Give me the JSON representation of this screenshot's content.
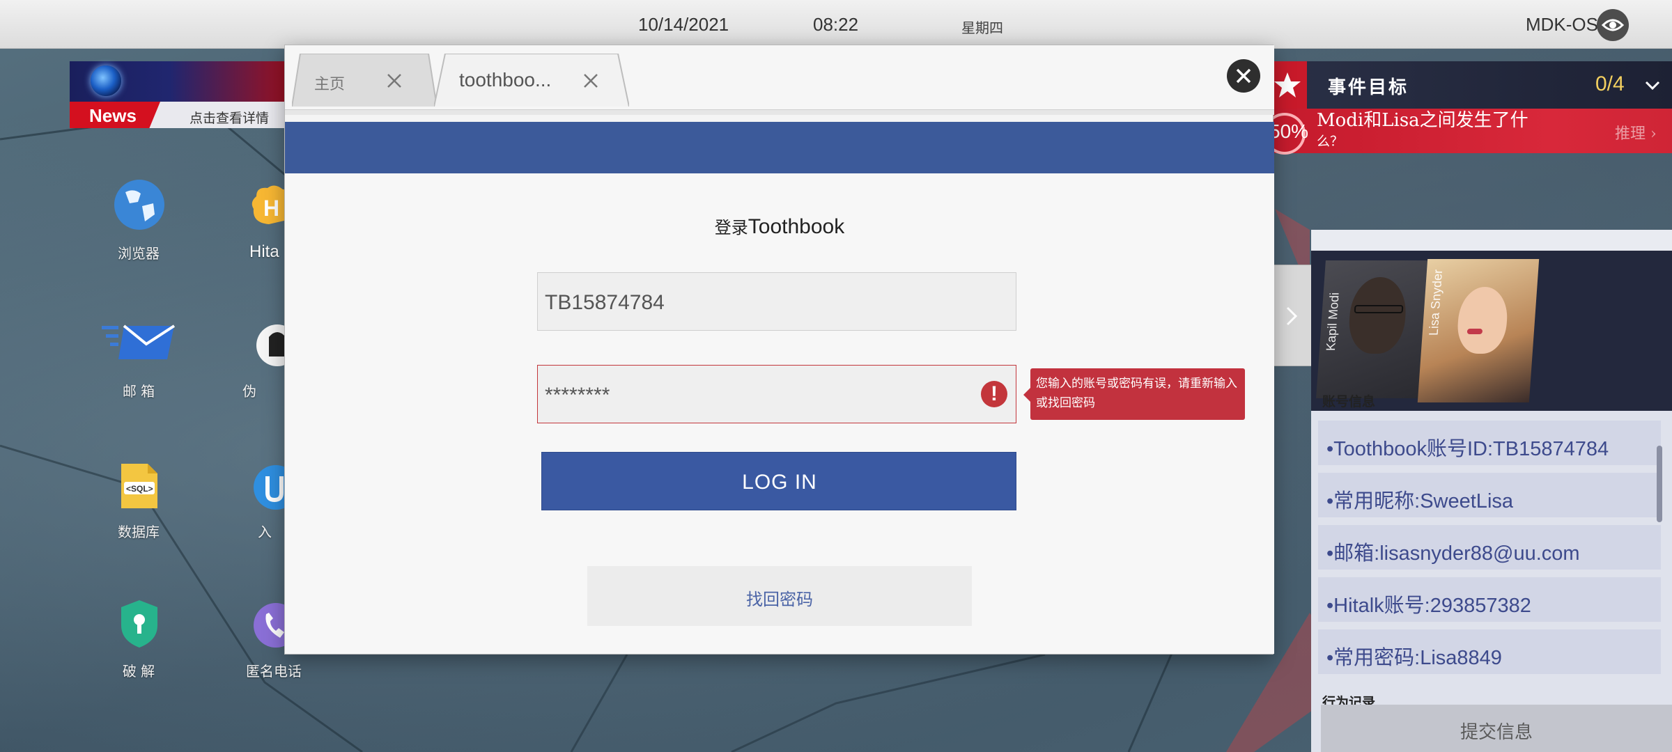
{
  "statusbar": {
    "date": "10/14/2021",
    "time": "08:22",
    "weekday": "星期四",
    "os_name": "MDK-OS"
  },
  "news": {
    "tag": "News",
    "ticker": "点击查看详情"
  },
  "desktop_icons": [
    {
      "label": "浏览器",
      "icon": "globe-icon"
    },
    {
      "label": "Hita",
      "icon": "hitalk-icon"
    },
    {
      "label": "邮 箱",
      "icon": "mail-icon"
    },
    {
      "label": "伪",
      "icon": "disguise-icon"
    },
    {
      "label": "数据库",
      "icon": "sql-database-icon"
    },
    {
      "label": "入",
      "icon": "intrusion-icon"
    },
    {
      "label": "破 解",
      "icon": "crack-shield-icon"
    },
    {
      "label": "匿名电话",
      "icon": "phone-icon"
    }
  ],
  "browser": {
    "tabs": [
      {
        "title": "主页",
        "active": false
      },
      {
        "title": "toothboo...",
        "active": true
      }
    ],
    "brand_color": "#3c5a9a",
    "login": {
      "title_prefix": "登录",
      "title_brand": "Toothbook",
      "username_value": "TB15874784",
      "password_value": "********",
      "error_tooltip": "您输入的账号或密码有误，请重新输入或找回密码",
      "login_button": "LOG IN",
      "forgot_button": "找回密码"
    }
  },
  "event_panel": {
    "title": "事件目标",
    "count": "0/4",
    "goal_percent": "50%",
    "goal_question_line1": "Modi和Lisa之间发生了什",
    "goal_question_line2": "么？",
    "goal_action": "推理"
  },
  "character_panel": {
    "characters": [
      "Kapil Modi",
      "Lisa Snyder"
    ],
    "section_account": "账号信息",
    "rows": [
      "•Toothbook账号ID:TB15874784",
      "•常用昵称:SweetLisa",
      "•邮箱:lisasnyder88@uu.com",
      "•Hitalk账号:293857382",
      "•常用密码:Lisa8849"
    ],
    "section_behavior": "行为记录",
    "submit_button": "提交信息"
  },
  "colors": {
    "accent_blue": "#3a59a2",
    "error_red": "#c2323e",
    "goal_red": "#c41a2c",
    "goal_count_yellow": "#f3d060"
  }
}
